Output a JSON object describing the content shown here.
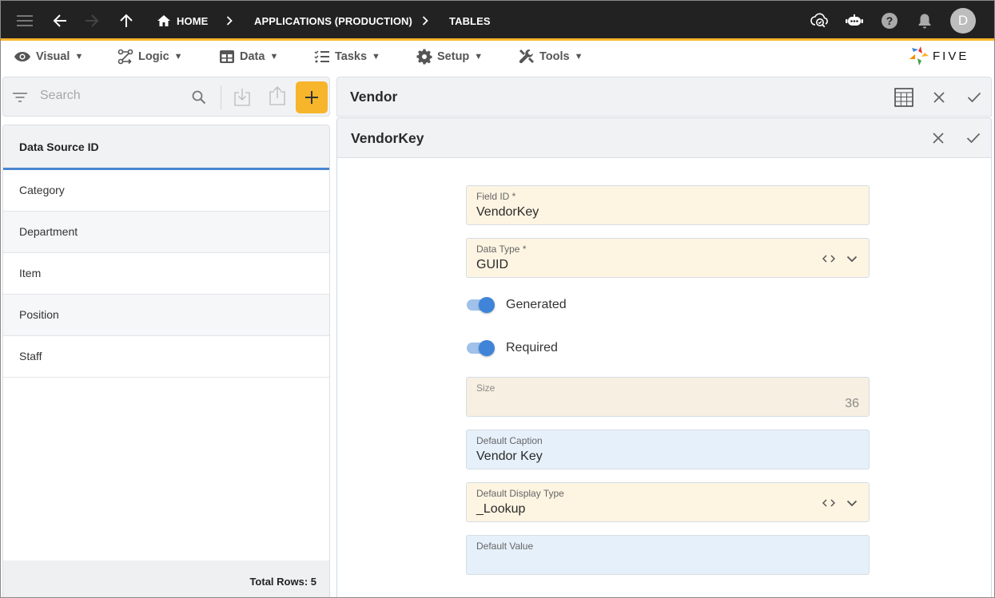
{
  "topbar": {
    "breadcrumbs": [
      {
        "label": "HOME",
        "icon": "home-icon"
      },
      {
        "label": "APPLICATIONS (PRODUCTION)"
      },
      {
        "label": "TABLES"
      }
    ],
    "icons": [
      "menu-icon",
      "back-arrow-icon",
      "forward-arrow-icon",
      "up-arrow-icon",
      "cloud-check-icon",
      "chatbot-icon",
      "help-icon",
      "bell-icon"
    ],
    "avatar_initial": "D"
  },
  "menubar": {
    "items": [
      {
        "label": "Visual",
        "icon": "eye-icon"
      },
      {
        "label": "Logic",
        "icon": "logic-flow-icon"
      },
      {
        "label": "Data",
        "icon": "table-grid-icon"
      },
      {
        "label": "Tasks",
        "icon": "checklist-icon"
      },
      {
        "label": "Setup",
        "icon": "gear-icon"
      },
      {
        "label": "Tools",
        "icon": "tools-icon"
      }
    ],
    "caret": "▼",
    "logo_text": "FIVE"
  },
  "left": {
    "search_placeholder": "Search",
    "column_header": "Data Source ID",
    "rows": [
      "Category",
      "Department",
      "Item",
      "Position",
      "Staff"
    ],
    "footer": "Total Rows: 5"
  },
  "right": {
    "record_title": "Vendor",
    "form_title": "VendorKey",
    "fields": {
      "field_id": {
        "label": "Field ID *",
        "value": "VendorKey"
      },
      "data_type": {
        "label": "Data Type *",
        "value": "GUID"
      },
      "generated": {
        "label": "Generated",
        "checked": true
      },
      "required": {
        "label": "Required",
        "checked": true
      },
      "size": {
        "label": "Size",
        "value": "36"
      },
      "default_caption": {
        "label": "Default Caption",
        "value": "Vendor Key"
      },
      "default_display_type": {
        "label": "Default Display Type",
        "value": "_Lookup"
      },
      "default_value": {
        "label": "Default Value",
        "value": ""
      }
    }
  },
  "colors": {
    "topbar": "#222222",
    "accent": "#f7b52c",
    "selection_blue": "#4a86d0",
    "toggle_on": "#3f84d8"
  }
}
